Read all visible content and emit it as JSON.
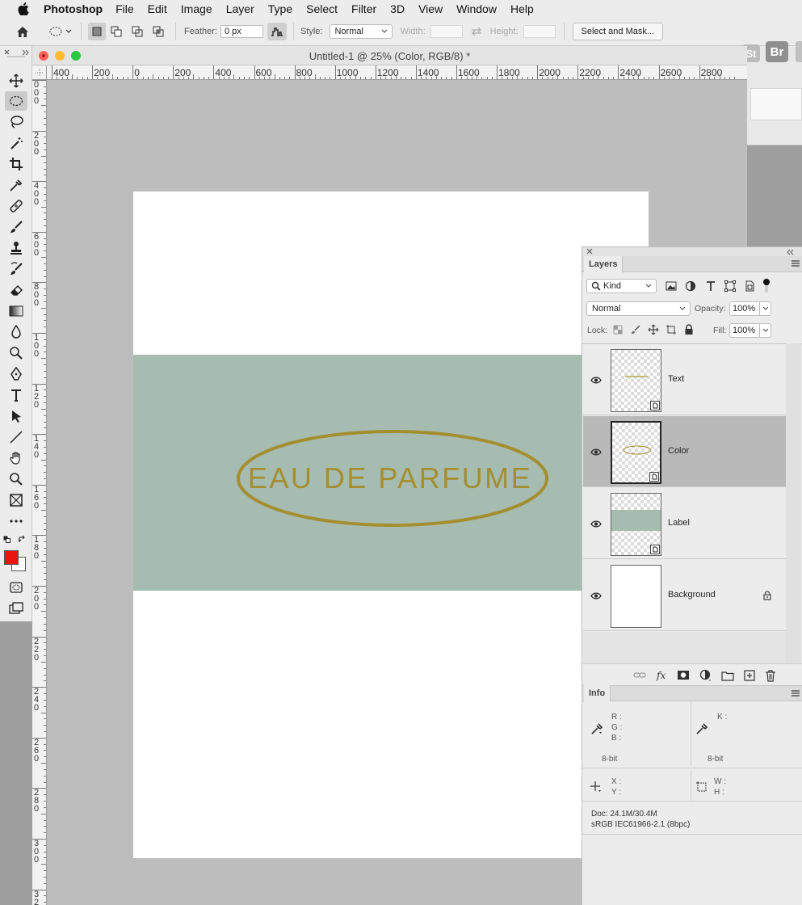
{
  "menubar": {
    "app_name": "Photoshop",
    "items": [
      "File",
      "Edit",
      "Image",
      "Layer",
      "Type",
      "Select",
      "Filter",
      "3D",
      "View",
      "Window",
      "Help"
    ]
  },
  "options_bar": {
    "feather_label": "Feather:",
    "feather_value": "0 px",
    "style_label": "Style:",
    "style_value": "Normal",
    "width_label": "Width:",
    "height_label": "Height:",
    "select_mask_label": "Select and Mask..."
  },
  "right_strip": {
    "br_label": "Br",
    "st_label": "St"
  },
  "document": {
    "title": "Untitled-1 @ 25% (Color, RGB/8) *",
    "h_ruler_labels": [
      "400",
      "200",
      "0",
      "200",
      "400",
      "600",
      "800",
      "1000",
      "1200",
      "1400",
      "1600",
      "1800",
      "2000",
      "2200",
      "2400",
      "2600",
      "2800"
    ],
    "v_ruler_labels": [
      "0",
      "2",
      "4",
      "6",
      "8",
      "1 0 0",
      "1 2 0",
      "1 4 0",
      "1 6 0",
      "1 8 0",
      "2 0 0",
      "2 2 0",
      "2 4 0",
      "2 6 0",
      "2 8 0",
      "3 0 0",
      "3 2"
    ],
    "artwork_text": "EAU DE PARFUME",
    "colors": {
      "band": "#a7bcb0",
      "gold": "#a38e30",
      "paper": "#ffffff"
    }
  },
  "colors": {
    "foreground": "#e8160f",
    "background": "#ffffff"
  },
  "layers_panel": {
    "tab": "Layers",
    "kind_label": "Kind",
    "blend_mode": "Normal",
    "opacity_label": "Opacity:",
    "opacity_value": "100%",
    "lock_label": "Lock:",
    "fill_label": "Fill:",
    "fill_value": "100%",
    "layers": [
      {
        "name": "Text",
        "selected": false
      },
      {
        "name": "Color",
        "selected": true
      },
      {
        "name": "Label",
        "selected": false
      },
      {
        "name": "Background",
        "selected": false,
        "locked": true
      }
    ]
  },
  "info_panel": {
    "tab": "Info",
    "rgb_labels": [
      "R :",
      "G :",
      "B :"
    ],
    "k_label": "K :",
    "bit_left": "8-bit",
    "bit_right": "8-bit",
    "xy_labels": [
      "X :",
      "Y :"
    ],
    "wh_labels": [
      "W :",
      "H :"
    ],
    "doc_size": "Doc: 24.1M/30.4M",
    "color_profile": "sRGB IEC61966-2.1 (8bpc)"
  }
}
